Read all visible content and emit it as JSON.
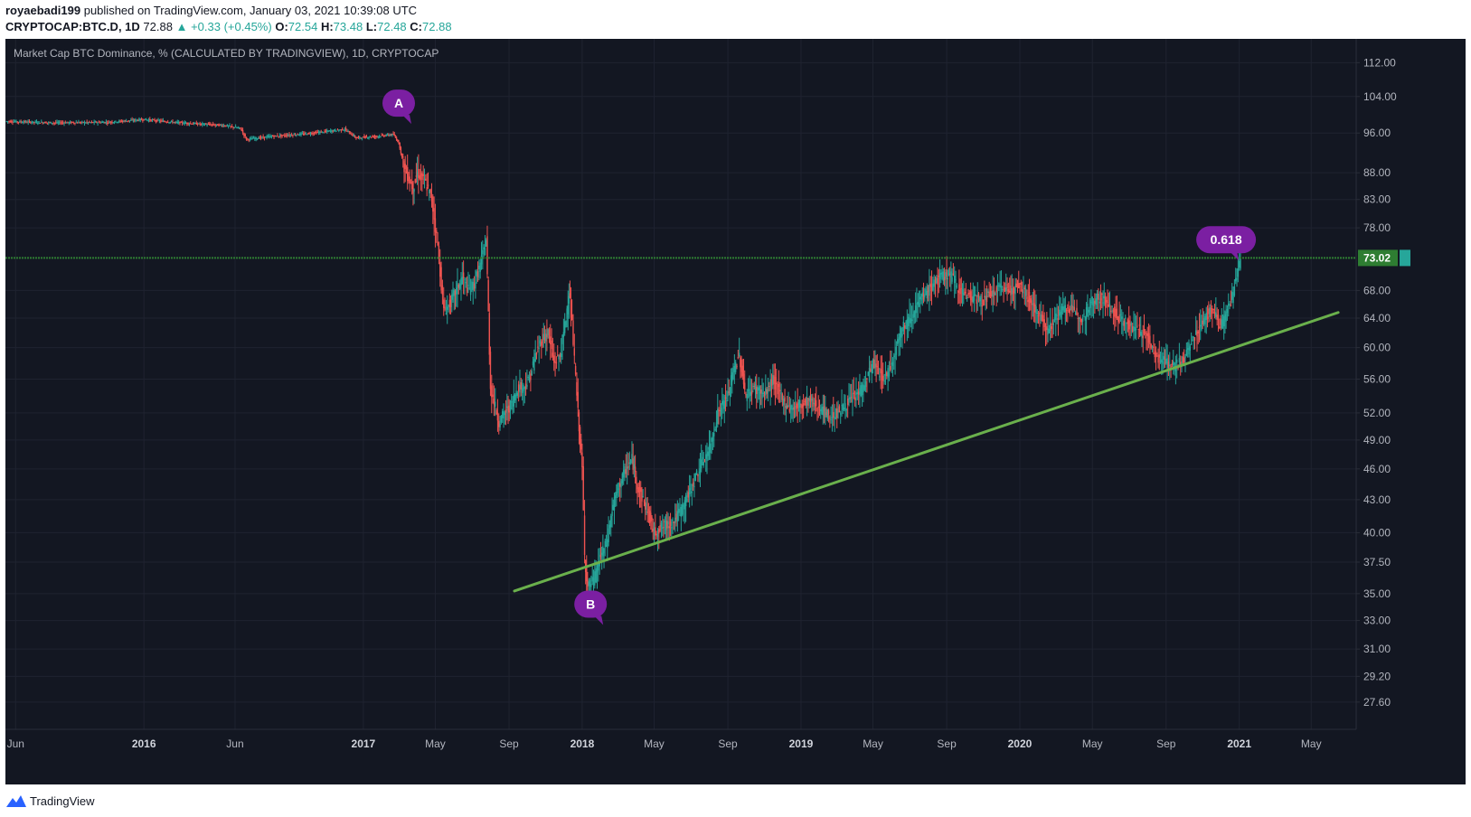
{
  "header": {
    "author": "royaebadi199",
    "publish_text": " published on TradingView.com, January 03, 2021 10:39:08 UTC",
    "symbol": "CRYPTOCAP:BTC.D, 1D",
    "last": "72.88",
    "change": "▲ +0.33 (+0.45%)",
    "o_label": "O:",
    "o_value": "72.54",
    "h_label": "H:",
    "h_value": "73.48",
    "l_label": "L:",
    "l_value": "72.48",
    "c_label": "C:",
    "c_value": "72.88"
  },
  "chart_title": "Market Cap BTC Dominance, % (CALCULATED BY TRADINGVIEW), 1D, CRYPTOCAP",
  "footer": {
    "brand": "TradingView"
  },
  "colors": {
    "background": "#131722",
    "grid": "#1f2330",
    "up": "#26a69a",
    "down": "#ef5350",
    "trendline": "#6ab04c",
    "hline": "#2e7d32",
    "marker": "#7b1fa2",
    "price_label": "#2e7d32"
  },
  "chart_data": {
    "type": "line",
    "title": "Market Cap BTC Dominance, % (CALCULATED BY TRADINGVIEW), 1D, CRYPTOCAP",
    "y_scale": "log",
    "ylim": [
      26,
      118
    ],
    "y_ticks": [
      "112.00",
      "104.00",
      "96.00",
      "88.00",
      "83.00",
      "78.00",
      "73.02",
      "68.00",
      "64.00",
      "60.00",
      "56.00",
      "52.00",
      "49.00",
      "46.00",
      "43.00",
      "40.00",
      "37.50",
      "35.00",
      "33.00",
      "31.00",
      "29.20",
      "27.60"
    ],
    "x_ticks": [
      {
        "date": "2015-06-01",
        "label": "Jun",
        "bold": false
      },
      {
        "date": "2016-01-01",
        "label": "2016",
        "bold": true
      },
      {
        "date": "2016-06-01",
        "label": "Jun",
        "bold": false
      },
      {
        "date": "2017-01-01",
        "label": "2017",
        "bold": true
      },
      {
        "date": "2017-05-01",
        "label": "May",
        "bold": false
      },
      {
        "date": "2017-09-01",
        "label": "Sep",
        "bold": false
      },
      {
        "date": "2018-01-01",
        "label": "2018",
        "bold": true
      },
      {
        "date": "2018-05-01",
        "label": "May",
        "bold": false
      },
      {
        "date": "2018-09-01",
        "label": "Sep",
        "bold": false
      },
      {
        "date": "2019-01-01",
        "label": "2019",
        "bold": true
      },
      {
        "date": "2019-05-01",
        "label": "May",
        "bold": false
      },
      {
        "date": "2019-09-01",
        "label": "Sep",
        "bold": false
      },
      {
        "date": "2020-01-01",
        "label": "2020",
        "bold": true
      },
      {
        "date": "2020-05-01",
        "label": "May",
        "bold": false
      },
      {
        "date": "2020-09-01",
        "label": "Sep",
        "bold": false
      },
      {
        "date": "2021-01-01",
        "label": "2021",
        "bold": true
      },
      {
        "date": "2021-05-01",
        "label": "May",
        "bold": false
      }
    ],
    "x_range": [
      "2015-05-15",
      "2021-07-15"
    ],
    "series": [
      {
        "name": "BTC.D",
        "points": [
          [
            "2015-05-15",
            98.5
          ],
          [
            "2015-08-01",
            98.2
          ],
          [
            "2015-11-01",
            98.3
          ],
          [
            "2016-01-01",
            98.9
          ],
          [
            "2016-03-01",
            98.2
          ],
          [
            "2016-05-15",
            97.6
          ],
          [
            "2016-06-10",
            97.0
          ],
          [
            "2016-06-20",
            94.7
          ],
          [
            "2016-08-01",
            95.3
          ],
          [
            "2016-10-01",
            95.9
          ],
          [
            "2016-12-01",
            96.8
          ],
          [
            "2016-12-20",
            95.0
          ],
          [
            "2017-01-20",
            95.3
          ],
          [
            "2017-02-20",
            95.7
          ],
          [
            "2017-03-01",
            94.0
          ],
          [
            "2017-03-10",
            89.0
          ],
          [
            "2017-03-25",
            85.0
          ],
          [
            "2017-04-01",
            88.0
          ],
          [
            "2017-04-15",
            86.0
          ],
          [
            "2017-04-25",
            83.0
          ],
          [
            "2017-05-05",
            75.0
          ],
          [
            "2017-05-15",
            65.0
          ],
          [
            "2017-05-25",
            66.0
          ],
          [
            "2017-06-05",
            68.0
          ],
          [
            "2017-06-15",
            70.0
          ],
          [
            "2017-06-25",
            68.0
          ],
          [
            "2017-07-05",
            69.0
          ],
          [
            "2017-07-15",
            72.0
          ],
          [
            "2017-07-25",
            76.0
          ],
          [
            "2017-08-01",
            55.0
          ],
          [
            "2017-08-15",
            51.0
          ],
          [
            "2017-08-25",
            52.0
          ],
          [
            "2017-09-05",
            53.0
          ],
          [
            "2017-09-15",
            55.0
          ],
          [
            "2017-09-25",
            55.0
          ],
          [
            "2017-10-05",
            56.0
          ],
          [
            "2017-10-15",
            59.0
          ],
          [
            "2017-10-25",
            61.0
          ],
          [
            "2017-11-05",
            62.0
          ],
          [
            "2017-11-15",
            58.0
          ],
          [
            "2017-11-25",
            59.0
          ],
          [
            "2017-12-05",
            64.0
          ],
          [
            "2017-12-10",
            68.0
          ],
          [
            "2017-12-15",
            63.0
          ],
          [
            "2017-12-25",
            52.0
          ],
          [
            "2018-01-01",
            46.0
          ],
          [
            "2018-01-05",
            38.0
          ],
          [
            "2018-01-10",
            35.5
          ],
          [
            "2018-01-20",
            36.0
          ],
          [
            "2018-02-01",
            38.0
          ],
          [
            "2018-02-10",
            39.0
          ],
          [
            "2018-02-20",
            42.0
          ],
          [
            "2018-03-01",
            44.0
          ],
          [
            "2018-03-15",
            46.0
          ],
          [
            "2018-03-25",
            47.0
          ],
          [
            "2018-04-05",
            44.0
          ],
          [
            "2018-04-20",
            42.0
          ],
          [
            "2018-05-01",
            40.0
          ],
          [
            "2018-05-15",
            40.5
          ],
          [
            "2018-06-01",
            41.0
          ],
          [
            "2018-06-15",
            42.0
          ],
          [
            "2018-07-01",
            44.0
          ],
          [
            "2018-07-15",
            46.0
          ],
          [
            "2018-08-01",
            48.0
          ],
          [
            "2018-08-15",
            52.0
          ],
          [
            "2018-09-01",
            54.0
          ],
          [
            "2018-09-10",
            57.0
          ],
          [
            "2018-09-20",
            59.0
          ],
          [
            "2018-10-01",
            54.0
          ],
          [
            "2018-10-15",
            55.0
          ],
          [
            "2018-11-01",
            54.0
          ],
          [
            "2018-11-15",
            56.0
          ],
          [
            "2018-12-01",
            53.5
          ],
          [
            "2018-12-15",
            52.5
          ],
          [
            "2019-01-01",
            53.0
          ],
          [
            "2019-01-15",
            53.5
          ],
          [
            "2019-02-01",
            52.5
          ],
          [
            "2019-02-20",
            51.5
          ],
          [
            "2019-03-10",
            52.5
          ],
          [
            "2019-04-01",
            54.0
          ],
          [
            "2019-04-15",
            55.0
          ],
          [
            "2019-05-01",
            58.0
          ],
          [
            "2019-05-10",
            57.0
          ],
          [
            "2019-05-20",
            56.0
          ],
          [
            "2019-06-01",
            58.0
          ],
          [
            "2019-06-15",
            62.0
          ],
          [
            "2019-07-01",
            64.0
          ],
          [
            "2019-07-15",
            66.0
          ],
          [
            "2019-08-01",
            68.0
          ],
          [
            "2019-08-15",
            69.5
          ],
          [
            "2019-09-01",
            70.5
          ],
          [
            "2019-09-10",
            70.0
          ],
          [
            "2019-09-20",
            68.5
          ],
          [
            "2019-10-01",
            67.5
          ],
          [
            "2019-10-15",
            67.0
          ],
          [
            "2019-11-01",
            66.5
          ],
          [
            "2019-11-15",
            67.5
          ],
          [
            "2019-12-01",
            68.5
          ],
          [
            "2019-12-15",
            68.0
          ],
          [
            "2020-01-01",
            68.5
          ],
          [
            "2020-01-15",
            67.0
          ],
          [
            "2020-02-01",
            64.5
          ],
          [
            "2020-02-15",
            62.5
          ],
          [
            "2020-03-01",
            64.0
          ],
          [
            "2020-03-15",
            65.5
          ],
          [
            "2020-04-01",
            65.0
          ],
          [
            "2020-04-15",
            64.0
          ],
          [
            "2020-05-01",
            66.5
          ],
          [
            "2020-05-15",
            67.0
          ],
          [
            "2020-06-01",
            65.5
          ],
          [
            "2020-06-15",
            64.0
          ],
          [
            "2020-07-01",
            63.0
          ],
          [
            "2020-07-15",
            62.5
          ],
          [
            "2020-08-01",
            61.5
          ],
          [
            "2020-08-15",
            59.0
          ],
          [
            "2020-09-01",
            58.0
          ],
          [
            "2020-09-15",
            57.5
          ],
          [
            "2020-10-01",
            58.5
          ],
          [
            "2020-10-15",
            61.0
          ],
          [
            "2020-11-01",
            63.5
          ],
          [
            "2020-11-15",
            65.5
          ],
          [
            "2020-12-01",
            63.0
          ],
          [
            "2020-12-10",
            64.5
          ],
          [
            "2020-12-20",
            67.0
          ],
          [
            "2021-01-03",
            72.88
          ]
        ]
      }
    ],
    "horizontal_line": {
      "value": 73.02,
      "label": "73.02"
    },
    "trendline": {
      "start": [
        "2017-09-10",
        35.2
      ],
      "end": [
        "2021-06-15",
        64.8
      ]
    },
    "annotations": [
      {
        "text": "A",
        "date": "2017-03-01",
        "value": 102.5
      },
      {
        "text": "B",
        "date": "2018-01-15",
        "value": 34.2
      },
      {
        "text": "0.618",
        "date": "2020-12-10",
        "value": 76.0
      }
    ]
  }
}
